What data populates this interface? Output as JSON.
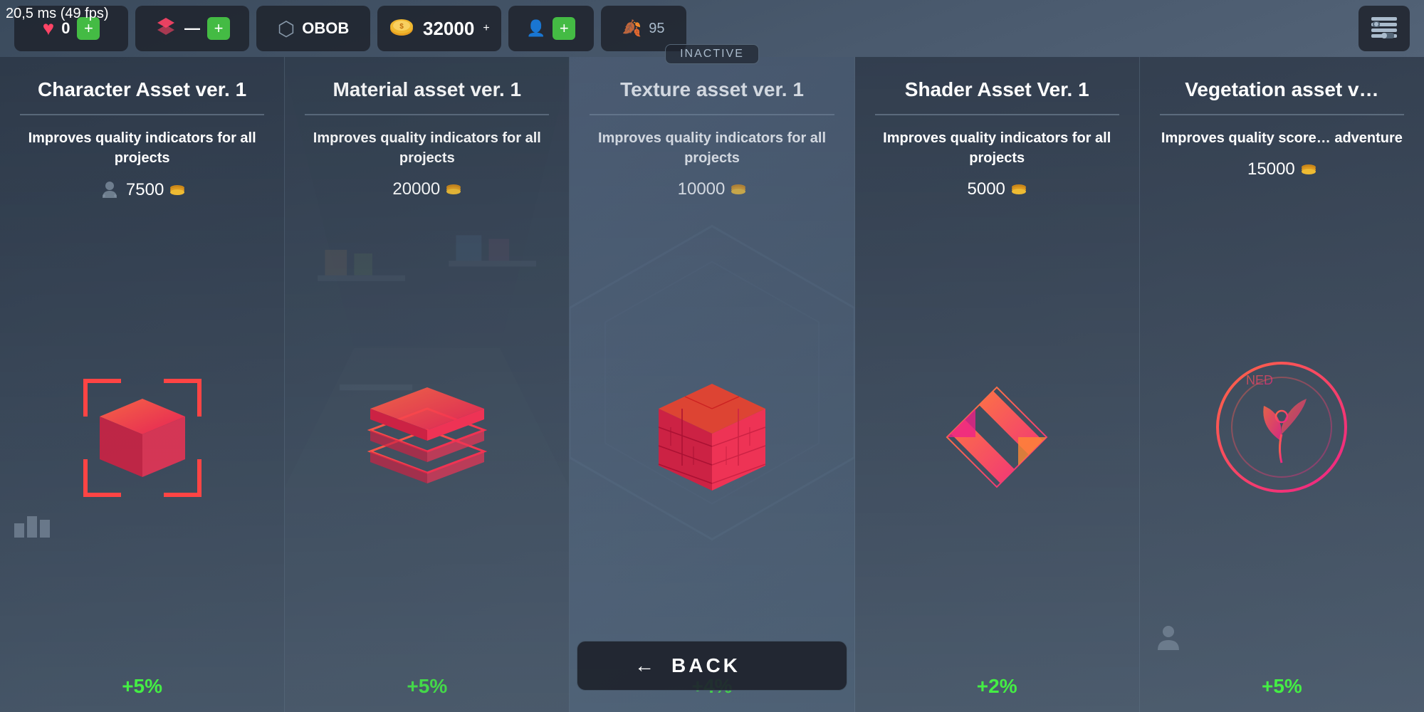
{
  "fps": "20,5 ms (49 fps)",
  "topbar": {
    "heart_value": "0",
    "layers_dash": "—",
    "dots_value": "OBOB",
    "coin_value": "32000",
    "plus_label": "+",
    "inactive_label": "INACTIVE",
    "settings_icon": "⚙"
  },
  "cards": [
    {
      "id": "character",
      "title": "Character Asset ver. 1",
      "description": "Improves quality indicators for all projects",
      "cost": "7500",
      "bonus": "+5%",
      "person_icon": true
    },
    {
      "id": "material",
      "title": "Material asset ver. 1",
      "description": "Improves quality indicators for all projects",
      "cost": "20000",
      "bonus": "+5%",
      "person_icon": false
    },
    {
      "id": "texture",
      "title": "Texture asset ver. 1",
      "description": "Improves quality indicators for all projects",
      "cost": "10000",
      "bonus": "+4%",
      "person_icon": false
    },
    {
      "id": "shader",
      "title": "Shader Asset Ver. 1",
      "description": "Improves quality indicators for all projects",
      "cost": "5000",
      "bonus": "+2%",
      "person_icon": false
    },
    {
      "id": "vegetation",
      "title": "Vegetation asset v…",
      "description": "Improves quality score… adventure",
      "cost": "15000",
      "bonus": "+5%",
      "person_icon": false
    }
  ],
  "back_button": {
    "label": "BACK",
    "arrow": "←"
  }
}
